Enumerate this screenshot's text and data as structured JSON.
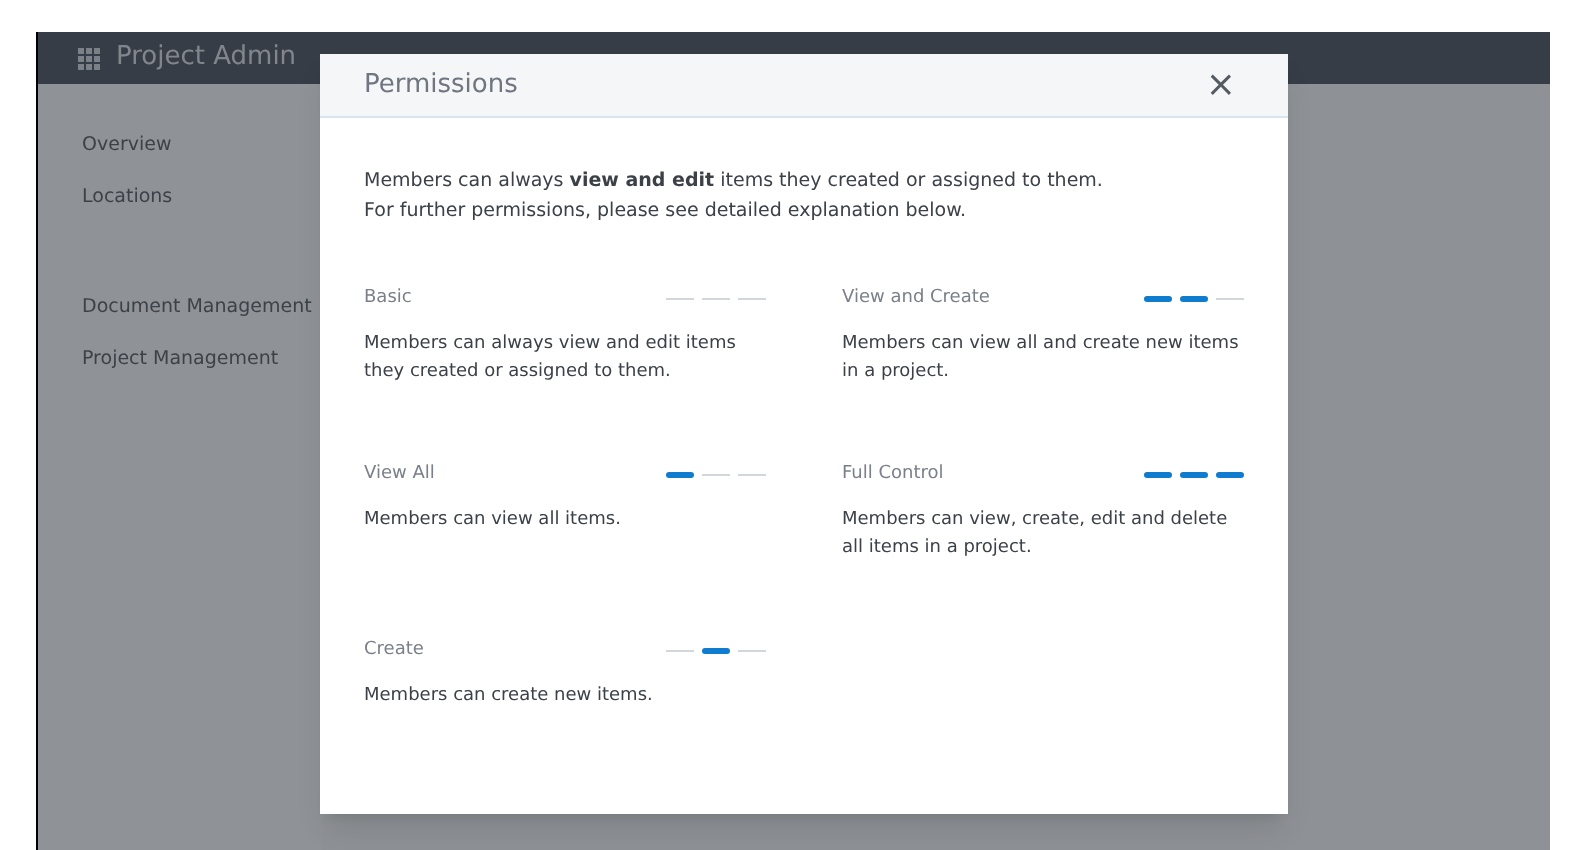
{
  "app": {
    "title": "Project Admin"
  },
  "sidebar": {
    "items": [
      {
        "label": "Overview"
      },
      {
        "label": "Locations"
      },
      {
        "label": "Document Management"
      },
      {
        "label": "Project Management"
      }
    ]
  },
  "dialog": {
    "title": "Permissions",
    "close": "×",
    "intro": [
      "Members can always **view and edit** items they created or assigned to them.",
      "For further permissions, please see detailed explanation below."
    ],
    "levels": [
      {
        "name": "Basic",
        "segments": [
          false,
          false,
          false
        ],
        "description": "Members can always view and edit items they created or assigned to them."
      },
      {
        "name": "View and Create",
        "segments": [
          true,
          true,
          false
        ],
        "description": "Members can view all and create new items in a project."
      },
      {
        "name": "View All",
        "segments": [
          true,
          false,
          false
        ],
        "description": "Members can view all items."
      },
      {
        "name": "Full Control",
        "segments": [
          true,
          true,
          true
        ],
        "description": "Members can view, create, edit and delete all items in a project."
      },
      {
        "name": "Create",
        "segments": [
          false,
          true,
          false
        ],
        "description": "Members can create new items."
      }
    ]
  }
}
